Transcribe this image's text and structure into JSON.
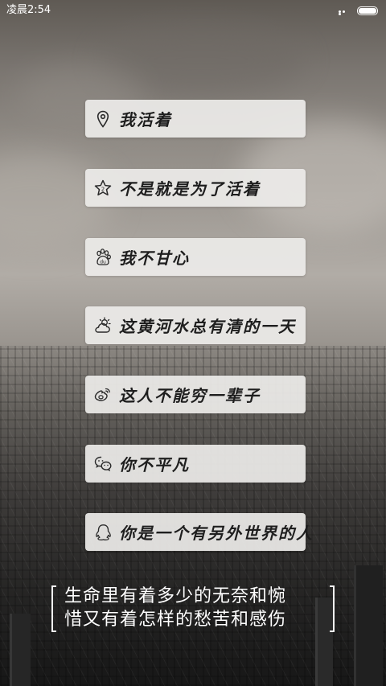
{
  "status_bar": {
    "time": "凌晨2:54",
    "battery_level": 1.0
  },
  "menu": {
    "items": [
      {
        "label": "我活着",
        "icon": "location-pin-icon"
      },
      {
        "label": "不是就是为了活着",
        "icon": "star-badge-icon"
      },
      {
        "label": "我不甘心",
        "icon": "baidu-paw-icon"
      },
      {
        "label": "这黄河水总有清的一天",
        "icon": "weather-cloud-sun-icon"
      },
      {
        "label": "这人不能穷一辈子",
        "icon": "weibo-icon"
      },
      {
        "label": "你不平凡",
        "icon": "wechat-icon"
      },
      {
        "label": "你是一个有另外世界的人",
        "icon": "qq-penguin-icon"
      }
    ]
  },
  "quote": {
    "line1": "生命里有着多少的无奈和惋",
    "line2": "惜又有着怎样的愁苦和感伤"
  }
}
